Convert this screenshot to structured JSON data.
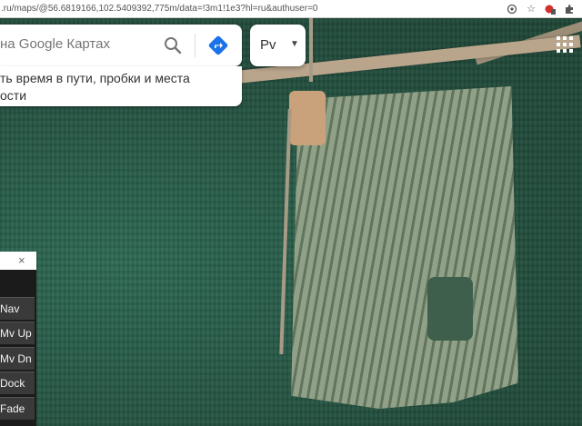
{
  "browser": {
    "url": ".ru/maps/@56.6819166,102.5409392,775m/data=!3m1!1e3?hl=ru&authuser=0"
  },
  "search": {
    "placeholder": "на Google Картах"
  },
  "hint": {
    "line1": "ть время в пути, пробки и места",
    "line2": "ости"
  },
  "layers": {
    "label": "Рv"
  },
  "dock_panel": {
    "close": "×",
    "buttons": [
      "Nav",
      "Mv Up",
      "Mv Dn",
      "Dock",
      "Fade"
    ]
  },
  "colors": {
    "directions_blue": "#1a73e8",
    "panel_bg": "#1b1b1b"
  }
}
